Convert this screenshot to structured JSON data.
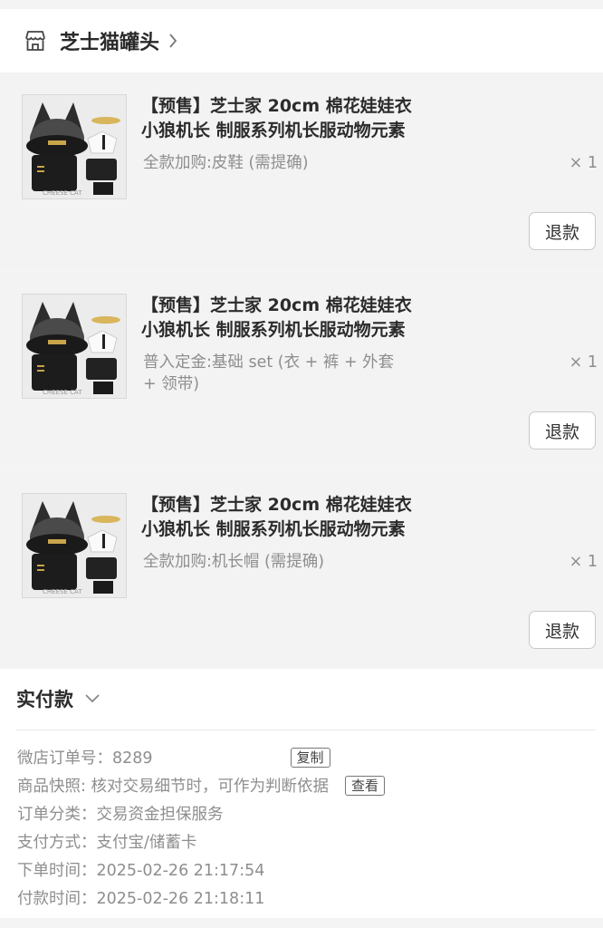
{
  "shop": {
    "name": "芝士猫罐头",
    "icon": "store-icon"
  },
  "items": [
    {
      "title_line1": "【预售】芝士家 20cm 棉花娃娃衣",
      "title_line2": "小狼机长 制服系列机长服动物元素",
      "spec_line1": "全款加购:皮鞋 (需提确)",
      "spec_line2": "",
      "qty": "× 1",
      "refund_label": "退款",
      "image_badge": "CHEESE CAT"
    },
    {
      "title_line1": "【预售】芝士家 20cm 棉花娃娃衣",
      "title_line2": "小狼机长 制服系列机长服动物元素",
      "spec_line1": "普入定金:基础 set (衣 + 裤 + 外套",
      "spec_line2": "+ 领带)",
      "qty": "× 1",
      "refund_label": "退款",
      "image_badge": "CHEESE CAT"
    },
    {
      "title_line1": "【预售】芝士家 20cm 棉花娃娃衣",
      "title_line2": "小狼机长 制服系列机长服动物元素",
      "spec_line1": "全款加购:机长帽 (需提确)",
      "spec_line2": "",
      "qty": "× 1",
      "refund_label": "退款",
      "image_badge": "CHEESE CAT"
    }
  ],
  "payment": {
    "label": "实付款",
    "order_no": "微店订单号：8289",
    "copy_label": "复制",
    "snapshot": "商品快照: 核对交易细节时，可作为判断依据",
    "view_label": "查看",
    "category": "订单分类：交易资金担保服务",
    "method": "支付方式：支付宝/储蓄卡",
    "order_time": "下单时间：2025-02-26 21:17:54",
    "pay_time": "付款时间：2025-02-26 21:18:11"
  }
}
